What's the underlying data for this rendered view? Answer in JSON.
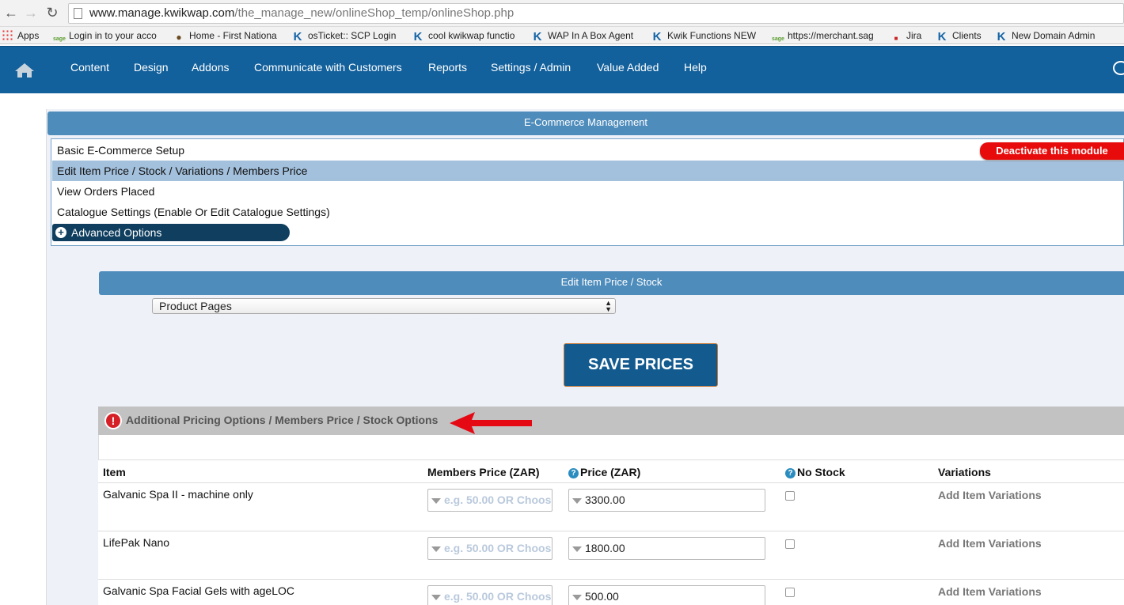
{
  "browser": {
    "url_host": "www.manage.kwikwap.com",
    "url_path": "/the_manage_new/onlineShop_temp/onlineShop.php",
    "bookmarks": [
      {
        "label": "Apps",
        "icon": "apps-grid-icon"
      },
      {
        "label": "Login in to your acco",
        "icon": "sage-icon"
      },
      {
        "label": "Home - First Nationa",
        "icon": "fnb-icon"
      },
      {
        "label": "osTicket:: SCP Login",
        "icon": "kwikwap-k-icon"
      },
      {
        "label": "cool kwikwap functio",
        "icon": "kwikwap-k-icon"
      },
      {
        "label": "WAP In A Box Agent",
        "icon": "kwikwap-k-icon"
      },
      {
        "label": "Kwik Functions NEW",
        "icon": "kwikwap-k-icon"
      },
      {
        "label": "https://merchant.sag",
        "icon": "sage-icon"
      },
      {
        "label": "Jira",
        "icon": "jira-icon"
      },
      {
        "label": "Clients",
        "icon": "kwikwap-k-icon"
      },
      {
        "label": "New Domain Admin",
        "icon": "kwikwap-k-icon"
      }
    ]
  },
  "topnav": {
    "items": [
      "Content",
      "Design",
      "Addons",
      "Communicate with Customers",
      "Reports",
      "Settings / Admin",
      "Value Added",
      "Help"
    ],
    "bg_color": "#12609c"
  },
  "ecommerce": {
    "header": "E-Commerce Management",
    "modules": [
      "Basic E-Commerce Setup",
      "Edit Item Price / Stock / Variations / Members Price",
      "View Orders Placed",
      "Catalogue Settings (Enable Or Edit Catalogue Settings)"
    ],
    "active_module": "Edit Item Price / Stock / Variations / Members Price",
    "advanced_options": "Advanced Options",
    "deactivate_label": "Deactivate this module"
  },
  "editor": {
    "header": "Edit Item Price / Stock",
    "page_select": "Product Pages",
    "save_label": "SAVE PRICES",
    "warning": "Additional Pricing Options / Members Price / Stock Options"
  },
  "table": {
    "columns": {
      "item": "Item",
      "members_price": "Members Price (ZAR)",
      "price": "Price (ZAR)",
      "no_stock": "No Stock",
      "variations": "Variations"
    },
    "members_placeholder": "e.g. 50.00 OR Choos",
    "rows": [
      {
        "item": "Galvanic Spa II - machine only",
        "price": "3300.00",
        "variations": "Add Item Variations"
      },
      {
        "item": "LifePak Nano",
        "price": "1800.00",
        "variations": "Add Item Variations"
      },
      {
        "item": "Galvanic Spa Facial Gels with ageLOC",
        "price": "500.00",
        "variations": "Add Item Variations"
      }
    ]
  }
}
